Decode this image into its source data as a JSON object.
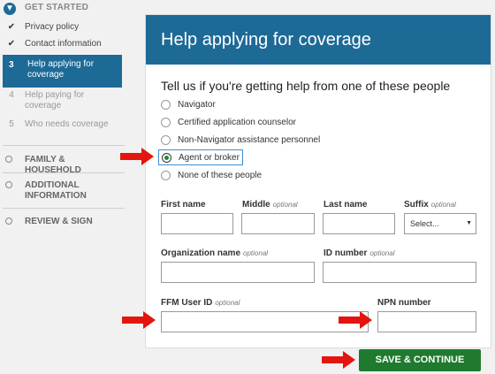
{
  "sidebar": {
    "section_started": {
      "icon": "chevron-down-icon",
      "label": "GET STARTED"
    },
    "steps": [
      {
        "icon": "check-icon",
        "label": "Privacy policy"
      },
      {
        "icon": "check-icon",
        "label": "Contact information"
      },
      {
        "number": "3",
        "label": "Help applying for coverage"
      },
      {
        "number": "4",
        "label": "Help paying for coverage"
      },
      {
        "number": "5",
        "label": "Who needs coverage"
      }
    ],
    "sections": [
      {
        "label": "FAMILY & HOUSEHOLD"
      },
      {
        "label": "ADDITIONAL INFORMATION"
      },
      {
        "label": "REVIEW & SIGN"
      }
    ]
  },
  "panel": {
    "title": "Help applying for coverage",
    "question": "Tell us if you're getting help from one of these people",
    "options": [
      "Navigator",
      "Certified application counselor",
      "Non-Navigator assistance personnel",
      "Agent or broker",
      "None of these people"
    ],
    "selected_option": "Agent or broker"
  },
  "form": {
    "first_name": {
      "label": "First name"
    },
    "middle": {
      "label": "Middle",
      "hint": "optional"
    },
    "last_name": {
      "label": "Last name"
    },
    "suffix": {
      "label": "Suffix",
      "hint": "optional",
      "value": "Select..."
    },
    "organization": {
      "label": "Organization name",
      "hint": "optional"
    },
    "id_number": {
      "label": "ID number",
      "hint": "optional"
    },
    "ffm_user_id": {
      "label": "FFM User ID",
      "hint": "optional"
    },
    "npn_number": {
      "label": "NPN number"
    }
  },
  "actions": {
    "save_continue": "SAVE & CONTINUE"
  },
  "colors": {
    "accent": "#1d6a97",
    "button": "#1f7a2f",
    "arrow": "#e4150f"
  }
}
